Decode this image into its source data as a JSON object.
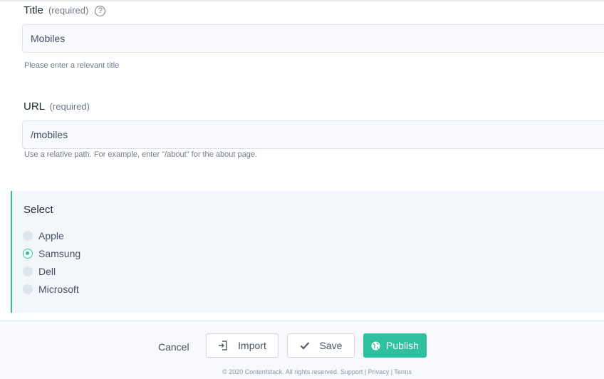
{
  "title_field": {
    "label": "Title",
    "required_text": "(required)",
    "help_icon": "?",
    "value": "Mobiles",
    "hint": "Please enter a relevant title"
  },
  "url_field": {
    "label": "URL",
    "required_text": "(required)",
    "value": "/mobiles",
    "hint": "Use a relative path. For example, enter \"/about\" for the about page."
  },
  "select_field": {
    "label": "Select",
    "options": [
      {
        "label": "Apple",
        "checked": false
      },
      {
        "label": "Samsung",
        "checked": true
      },
      {
        "label": "Dell",
        "checked": false
      },
      {
        "label": "Microsoft",
        "checked": false
      }
    ]
  },
  "footer": {
    "cancel_label": "Cancel",
    "import_label": "Import",
    "import_icon": "import-icon",
    "save_label": "Save",
    "save_icon": "check-icon",
    "publish_label": "Publish",
    "publish_icon": "globe-icon",
    "copyright": "© 2020 Contentstack. All rights reserved. Support | Privacy | Terms"
  },
  "colors": {
    "accent": "#2ec1a0",
    "select_bg": "#f3f7fb"
  }
}
